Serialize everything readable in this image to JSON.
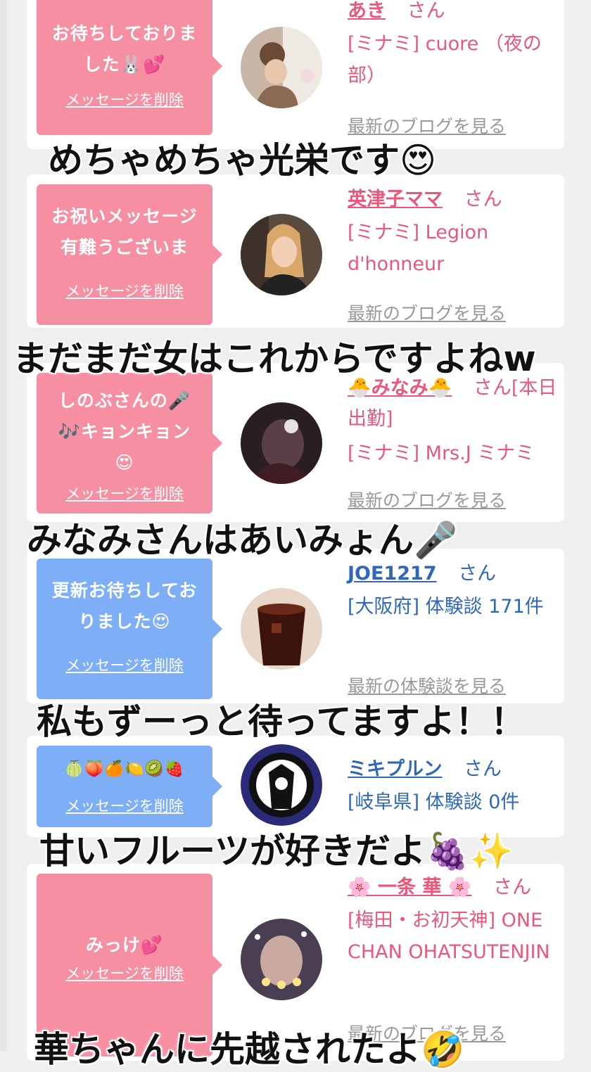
{
  "cards": [
    {
      "bubble_text": "お待ちしておりま\nした🐰💕",
      "bubble_color": "#f78fa3",
      "delete_label": "メッセージを削除",
      "name": "あき",
      "honorific": "さん",
      "detail": "[ミナミ] cuore （夜の部）",
      "link": "最新のブログを見る",
      "avatar": "photo-woman-hair-up"
    },
    {
      "bubble_text": "お祝いメッセージ\n有難うございま",
      "bubble_color": "#f78fa3",
      "delete_label": "メッセージを削除",
      "name": "英津子ママ",
      "honorific": "さん",
      "detail": "[ミナミ] Legion d'honneur",
      "link": "最新のブログを見る",
      "avatar": "photo-blonde-woman"
    },
    {
      "bubble_text": "しのぶさんの🎤\n🎶キョンキョン\n😍",
      "bubble_color": "#f78fa3",
      "delete_label": "メッセージを削除",
      "name": "🐣みなみ🐣",
      "honorific": "さん[本日出勤]",
      "detail": "[ミナミ] Mrs.J ミナミ",
      "link": "最新のブログを見る",
      "avatar": "photo-dark-blur"
    },
    {
      "bubble_text": "更新お待ちしてお\nりました😍",
      "bubble_color": "#7daef6",
      "delete_label": "メッセージを削除",
      "name": "JOE1217",
      "honorific": "さん",
      "detail": "[大阪府] 体験談 171件",
      "link": "最新の体験談を見る",
      "avatar": "photo-iced-coffee"
    },
    {
      "bubble_text": "🍈🍑🍊🍋🥝🍓",
      "bubble_color": "#7daef6",
      "delete_label": "メッセージを削除",
      "name": "ミキプルン",
      "honorific": "さん",
      "detail": "[岐阜県] 体験談 0件",
      "link": "",
      "avatar": "starbucks-logo"
    },
    {
      "bubble_text": "みっけ💕",
      "bubble_color": "#f78fa3",
      "delete_label": "メッセージを削除",
      "name": "🌸 一条 華 🌸",
      "honorific": "さん",
      "detail": "[梅田・お初天神] ONE CHAN OHATSUTENJIN",
      "link": "最新のブログを見る",
      "avatar": "photo-sparkle-blur"
    }
  ],
  "captions": [
    "めちゃめちゃ光栄です😍",
    "まだまだ女はこれからですよねw",
    "みなみさんはあいみょん🎤",
    "私もずーっと待ってますよ！！",
    "甘いフルーツが好きだよ🍇✨",
    "華ちゃんに先越されたよ🤣"
  ]
}
